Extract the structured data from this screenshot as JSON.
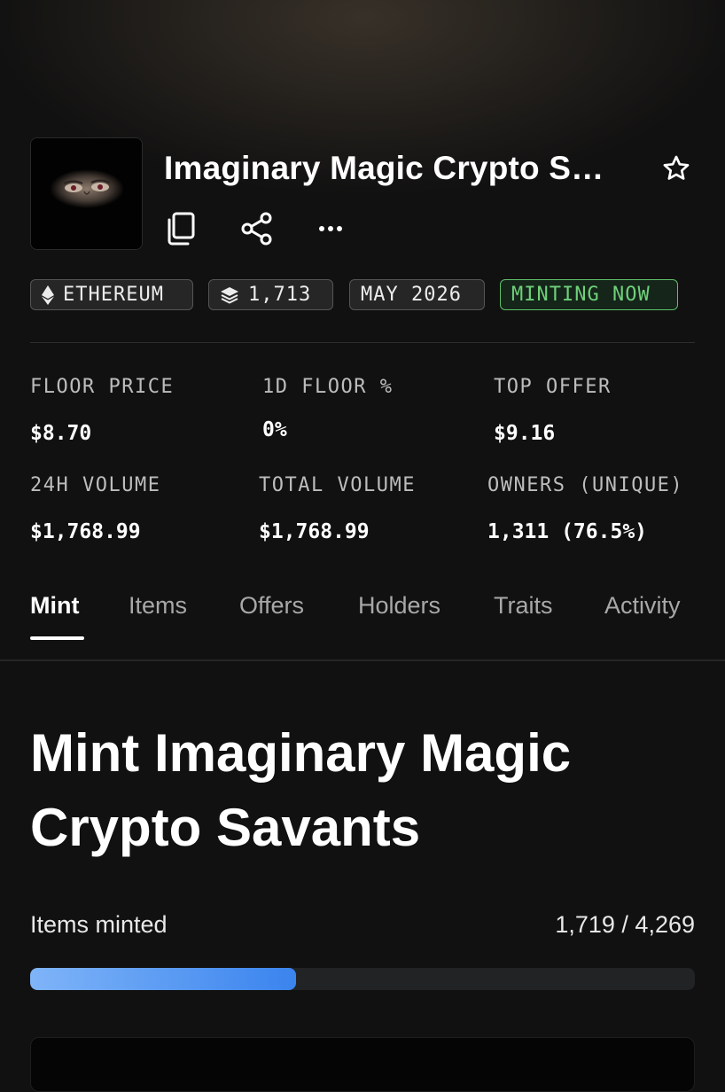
{
  "collection": {
    "title": "Imaginary Magic Crypto Savants",
    "title_display": "Imaginary Magic Crypto S…"
  },
  "header_icons": [
    "copy-icon",
    "share-icon",
    "more-icon",
    "star-icon"
  ],
  "chips": {
    "chain": "ETHEREUM",
    "items": "1,713",
    "date": "MAY 2026",
    "status": "MINTING NOW"
  },
  "stats": {
    "floor_price": {
      "label": "FLOOR PRICE",
      "value": "$8.70"
    },
    "floor_change": {
      "label": "1D FLOOR %",
      "value": "0%"
    },
    "top_offer": {
      "label": "TOP OFFER",
      "value": "$9.16"
    },
    "volume_24h": {
      "label": "24H VOLUME",
      "value": "$1,768.99"
    },
    "total_volume": {
      "label": "TOTAL VOLUME",
      "value": "$1,768.99"
    },
    "owners": {
      "label": "OWNERS (UNIQUE)",
      "value": "1,311 (76.5%)"
    }
  },
  "tabs": [
    "Mint",
    "Items",
    "Offers",
    "Holders",
    "Traits",
    "Activity"
  ],
  "active_tab": "Mint",
  "mint": {
    "heading": "Mint Imaginary Magic Crypto Savants",
    "items_minted_label": "Items minted",
    "items_minted_count": "1,719 / 4,269",
    "minted": 1719,
    "supply": 4269,
    "progress_fraction": 0.4
  },
  "colors": {
    "background": "#111111",
    "minting_green": "#6fd07a",
    "progress_start": "#7fb4f8",
    "progress_end": "#3a84ee"
  }
}
